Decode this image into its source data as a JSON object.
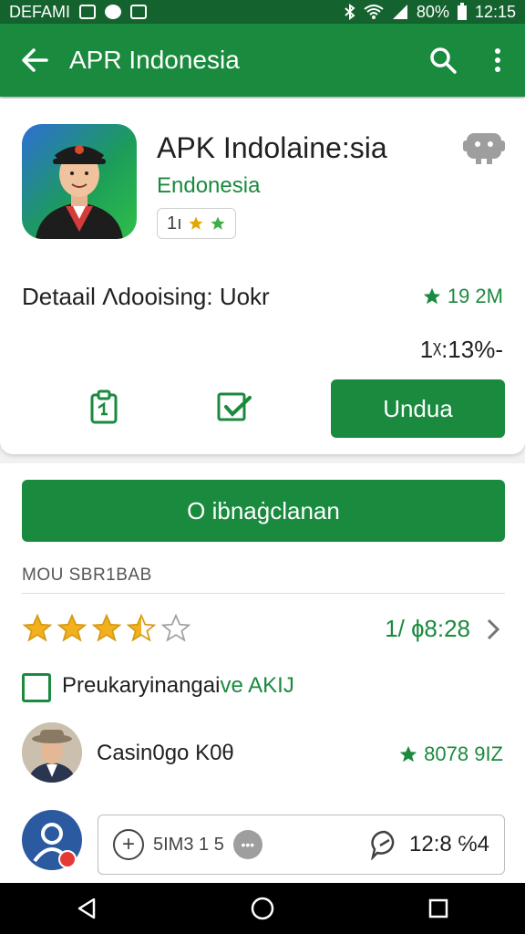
{
  "status_bar": {
    "left_text": "DEFAMI",
    "battery": "80%",
    "time": "12:15"
  },
  "app_bar": {
    "title": "APR Indonesia"
  },
  "app": {
    "name": "APK Indolaine:sia",
    "developer": "Endonesia",
    "badge_value": "1ı",
    "detail_label": "Detaail Ʌdooising: Uokr",
    "rating": "19 2M",
    "count": "1ᵡ:13%-",
    "install_label": "Undua"
  },
  "secondary": {
    "big_button_label": "O iḃnaġclanan",
    "section_label": "MOU SBR1BAB",
    "rating_value": "1/ ɸ8:28",
    "star_rating": 3.5,
    "checkbox_label_prefix": "Preukaryinangai",
    "checkbox_label_highlight": "ve AKIJ",
    "review_name": "Casin0go K0θ",
    "review_rating": "8078 9IZ",
    "composer_text": "5IM3 1 5",
    "composer_time": "12:8 ℅4"
  },
  "colors": {
    "primary": "#1a8a3e",
    "status_bar": "#14632f",
    "star": "#f2b01e"
  }
}
